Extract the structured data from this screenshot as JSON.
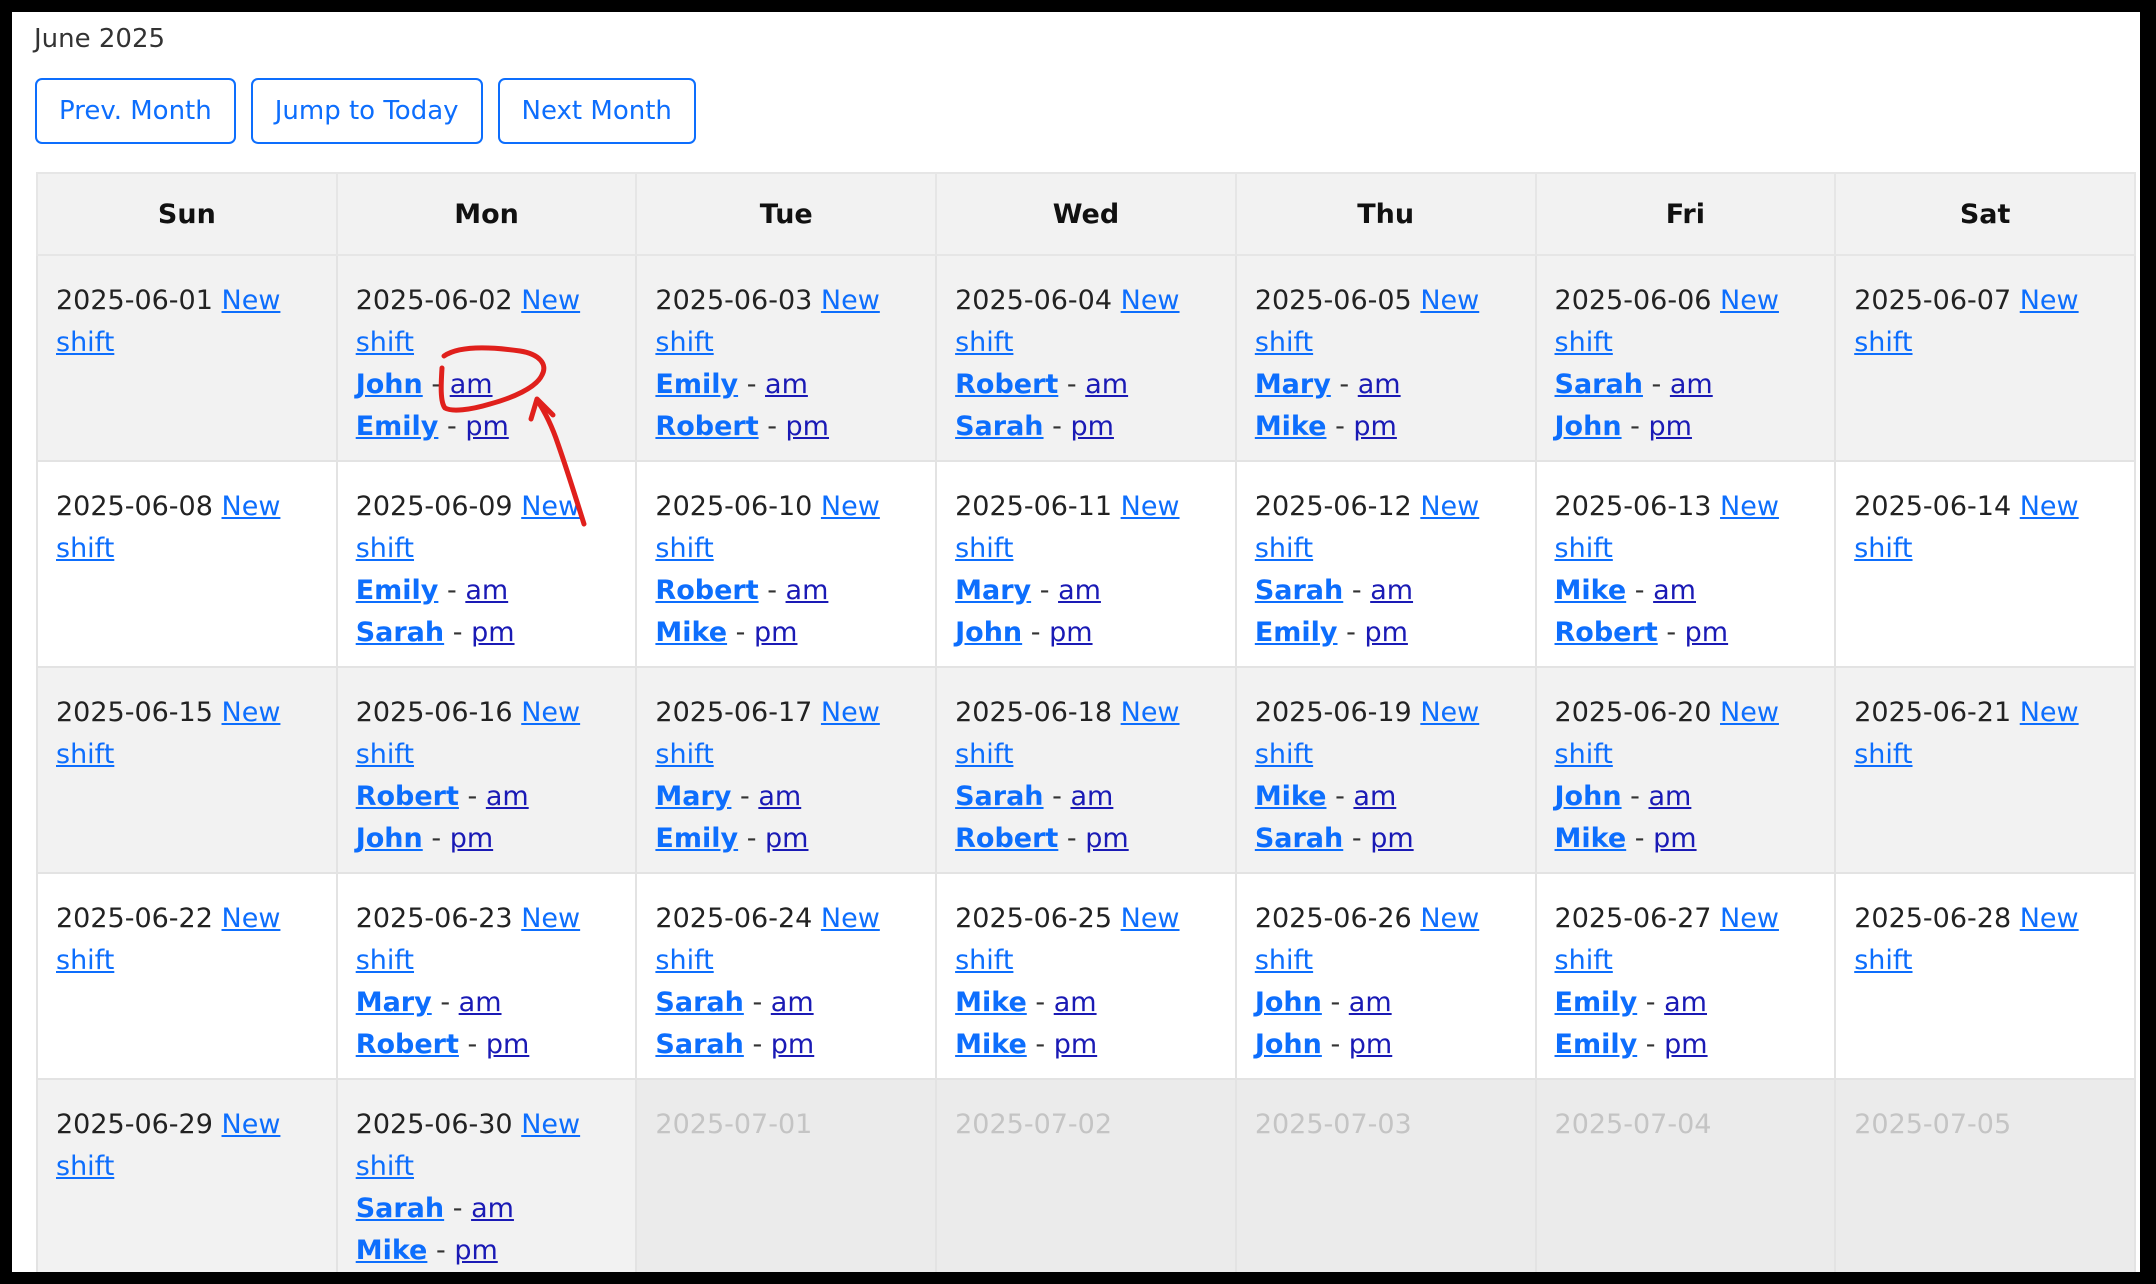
{
  "title": "June 2025",
  "buttons": {
    "prev": "Prev. Month",
    "today": "Jump to Today",
    "next": "Next Month"
  },
  "weekdays": [
    "Sun",
    "Mon",
    "Tue",
    "Wed",
    "Thu",
    "Fri",
    "Sat"
  ],
  "new_shift_label": "New shift",
  "separator": "-",
  "weeks": [
    [
      {
        "date": "2025-06-01",
        "shifts": []
      },
      {
        "date": "2025-06-02",
        "shifts": [
          {
            "name": "John",
            "period": "am"
          },
          {
            "name": "Emily",
            "period": "pm"
          }
        ]
      },
      {
        "date": "2025-06-03",
        "shifts": [
          {
            "name": "Emily",
            "period": "am"
          },
          {
            "name": "Robert",
            "period": "pm"
          }
        ]
      },
      {
        "date": "2025-06-04",
        "shifts": [
          {
            "name": "Robert",
            "period": "am"
          },
          {
            "name": "Sarah",
            "period": "pm"
          }
        ]
      },
      {
        "date": "2025-06-05",
        "shifts": [
          {
            "name": "Mary",
            "period": "am"
          },
          {
            "name": "Mike",
            "period": "pm"
          }
        ]
      },
      {
        "date": "2025-06-06",
        "shifts": [
          {
            "name": "Sarah",
            "period": "am"
          },
          {
            "name": "John",
            "period": "pm"
          }
        ]
      },
      {
        "date": "2025-06-07",
        "shifts": []
      }
    ],
    [
      {
        "date": "2025-06-08",
        "shifts": []
      },
      {
        "date": "2025-06-09",
        "shifts": [
          {
            "name": "Emily",
            "period": "am"
          },
          {
            "name": "Sarah",
            "period": "pm"
          }
        ]
      },
      {
        "date": "2025-06-10",
        "shifts": [
          {
            "name": "Robert",
            "period": "am"
          },
          {
            "name": "Mike",
            "period": "pm"
          }
        ]
      },
      {
        "date": "2025-06-11",
        "shifts": [
          {
            "name": "Mary",
            "period": "am"
          },
          {
            "name": "John",
            "period": "pm"
          }
        ]
      },
      {
        "date": "2025-06-12",
        "shifts": [
          {
            "name": "Sarah",
            "period": "am"
          },
          {
            "name": "Emily",
            "period": "pm"
          }
        ]
      },
      {
        "date": "2025-06-13",
        "shifts": [
          {
            "name": "Mike",
            "period": "am"
          },
          {
            "name": "Robert",
            "period": "pm"
          }
        ]
      },
      {
        "date": "2025-06-14",
        "shifts": []
      }
    ],
    [
      {
        "date": "2025-06-15",
        "shifts": []
      },
      {
        "date": "2025-06-16",
        "shifts": [
          {
            "name": "Robert",
            "period": "am"
          },
          {
            "name": "John",
            "period": "pm"
          }
        ]
      },
      {
        "date": "2025-06-17",
        "shifts": [
          {
            "name": "Mary",
            "period": "am"
          },
          {
            "name": "Emily",
            "period": "pm"
          }
        ]
      },
      {
        "date": "2025-06-18",
        "shifts": [
          {
            "name": "Sarah",
            "period": "am"
          },
          {
            "name": "Robert",
            "period": "pm"
          }
        ]
      },
      {
        "date": "2025-06-19",
        "shifts": [
          {
            "name": "Mike",
            "period": "am"
          },
          {
            "name": "Sarah",
            "period": "pm"
          }
        ]
      },
      {
        "date": "2025-06-20",
        "shifts": [
          {
            "name": "John",
            "period": "am"
          },
          {
            "name": "Mike",
            "period": "pm"
          }
        ]
      },
      {
        "date": "2025-06-21",
        "shifts": []
      }
    ],
    [
      {
        "date": "2025-06-22",
        "shifts": []
      },
      {
        "date": "2025-06-23",
        "shifts": [
          {
            "name": "Mary",
            "period": "am"
          },
          {
            "name": "Robert",
            "period": "pm"
          }
        ]
      },
      {
        "date": "2025-06-24",
        "shifts": [
          {
            "name": "Sarah",
            "period": "am"
          },
          {
            "name": "Sarah",
            "period": "pm"
          }
        ]
      },
      {
        "date": "2025-06-25",
        "shifts": [
          {
            "name": "Mike",
            "period": "am"
          },
          {
            "name": "Mike",
            "period": "pm"
          }
        ]
      },
      {
        "date": "2025-06-26",
        "shifts": [
          {
            "name": "John",
            "period": "am"
          },
          {
            "name": "John",
            "period": "pm"
          }
        ]
      },
      {
        "date": "2025-06-27",
        "shifts": [
          {
            "name": "Emily",
            "period": "am"
          },
          {
            "name": "Emily",
            "period": "pm"
          }
        ]
      },
      {
        "date": "2025-06-28",
        "shifts": []
      }
    ],
    [
      {
        "date": "2025-06-29",
        "shifts": []
      },
      {
        "date": "2025-06-30",
        "shifts": [
          {
            "name": "Sarah",
            "period": "am"
          },
          {
            "name": "Mike",
            "period": "pm"
          }
        ]
      },
      {
        "date": "2025-07-01",
        "other_month": true
      },
      {
        "date": "2025-07-02",
        "other_month": true
      },
      {
        "date": "2025-07-03",
        "other_month": true
      },
      {
        "date": "2025-07-04",
        "other_month": true
      },
      {
        "date": "2025-07-05",
        "other_month": true
      }
    ]
  ],
  "colors": {
    "accent": "#0d6efd",
    "shift_link": "#1a1ab5",
    "annotation": "#e0201c",
    "header_bg": "#f2f2f2"
  }
}
